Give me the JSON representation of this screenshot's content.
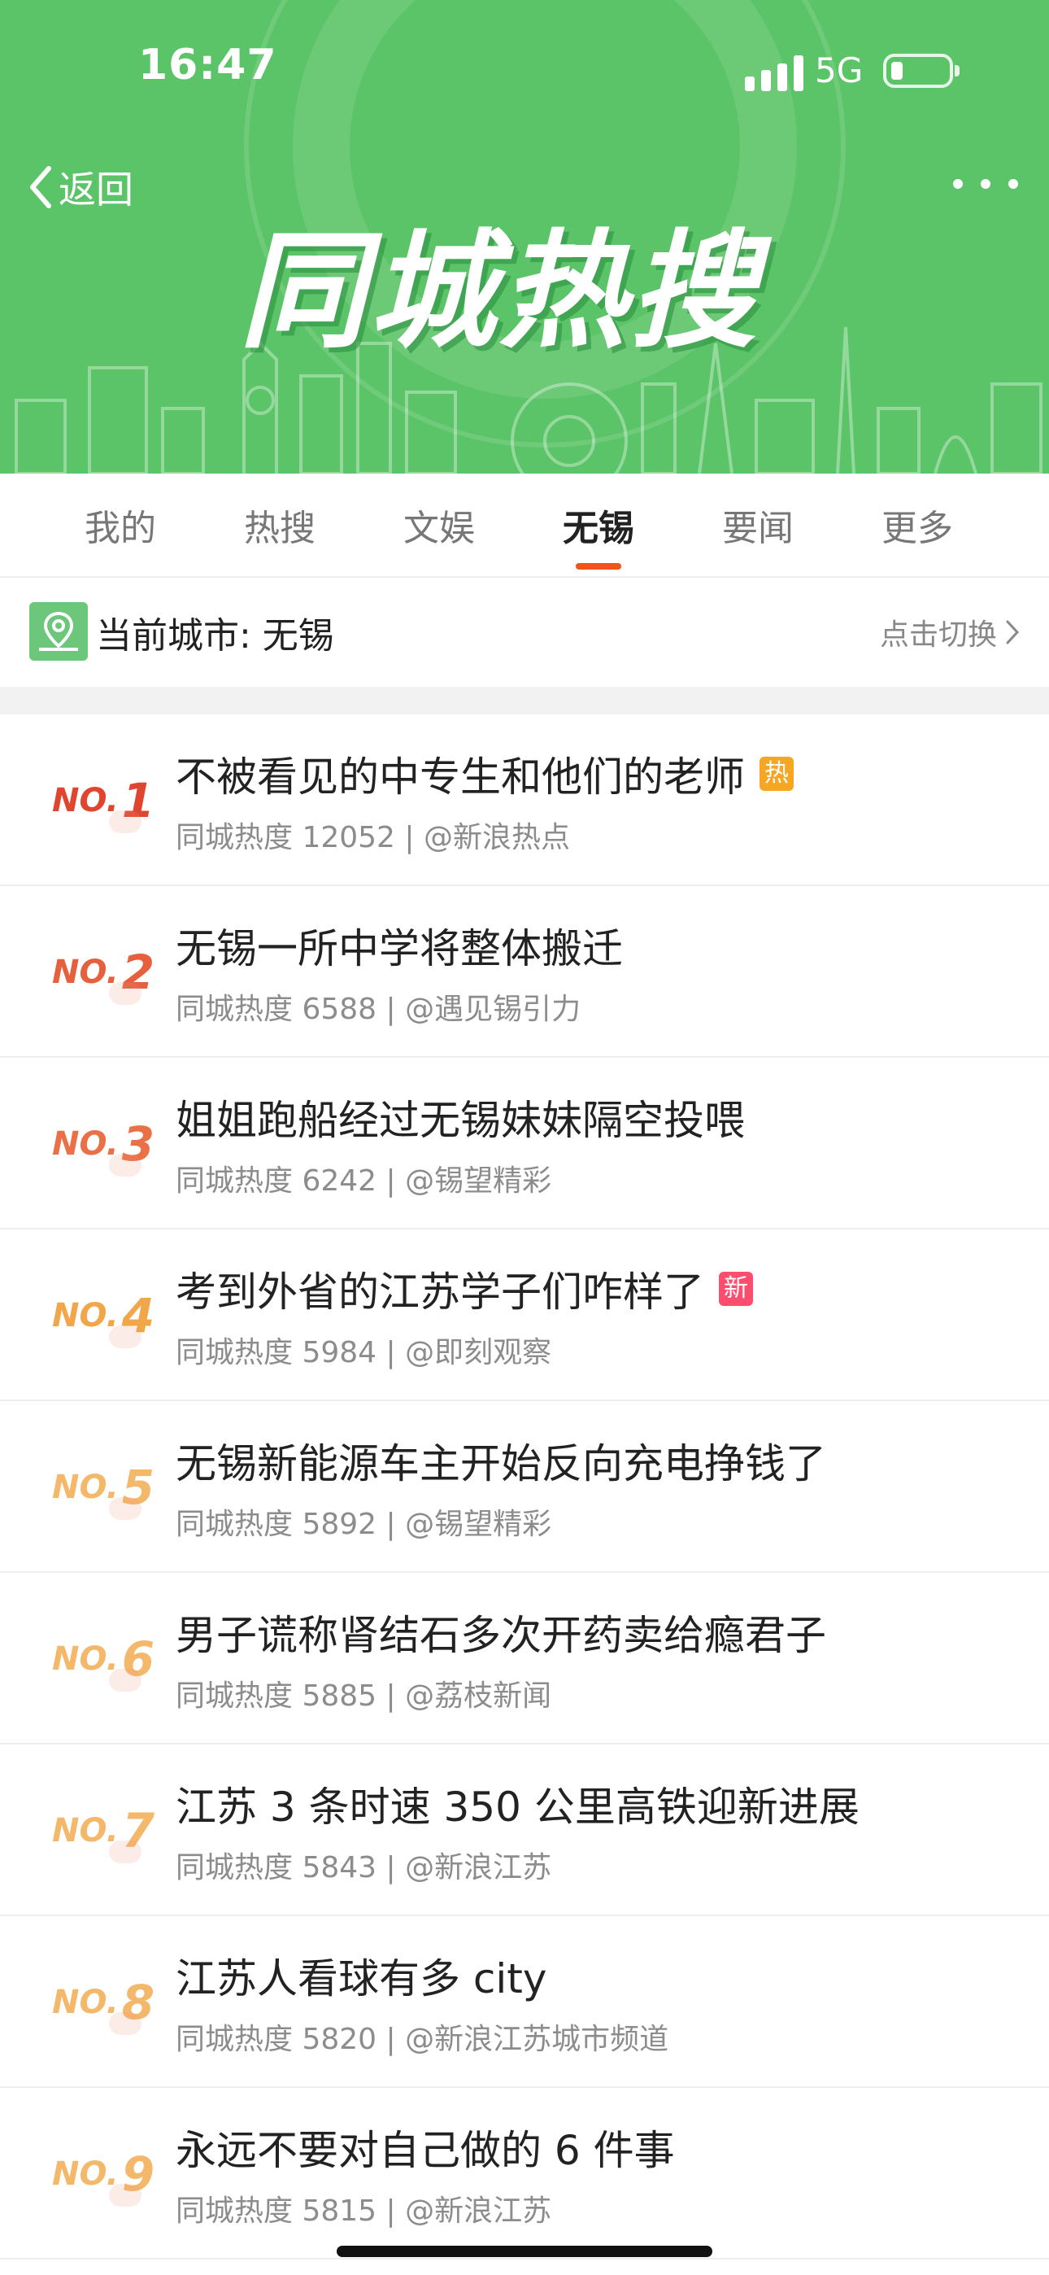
{
  "status": {
    "time": "16:47",
    "network": "5G"
  },
  "nav": {
    "back_label": "返回",
    "banner_title": "同城热搜"
  },
  "tabs": [
    {
      "label": "我的",
      "active": false
    },
    {
      "label": "热搜",
      "active": false
    },
    {
      "label": "文娱",
      "active": false
    },
    {
      "label": "无锡",
      "active": true
    },
    {
      "label": "要闻",
      "active": false
    },
    {
      "label": "更多",
      "active": false
    }
  ],
  "city": {
    "label": "当前城市: 无锡",
    "switch_label": "点击切换"
  },
  "items": [
    {
      "no": "NO.",
      "rank": "1",
      "title": "不被看见的中专生和他们的老师",
      "badge": "热",
      "badge_type": "hot",
      "meta": "同城热度 12052 | @新浪热点",
      "rank_color": "#e0462f"
    },
    {
      "no": "NO.",
      "rank": "2",
      "title": "无锡一所中学将整体搬迁",
      "badge": "",
      "badge_type": "",
      "meta": "同城热度 6588 | @遇见锡引力",
      "rank_color": "#e6603e"
    },
    {
      "no": "NO.",
      "rank": "3",
      "title": "姐姐跑船经过无锡妹妹隔空投喂",
      "badge": "",
      "badge_type": "",
      "meta": "同城热度 6242 | @锡望精彩",
      "rank_color": "#ea7048"
    },
    {
      "no": "NO.",
      "rank": "4",
      "title": "考到外省的江苏学子们咋样了",
      "badge": "新",
      "badge_type": "new",
      "meta": "同城热度 5984 | @即刻观察",
      "rank_color": "#f2a64a"
    },
    {
      "no": "NO.",
      "rank": "5",
      "title": "无锡新能源车主开始反向充电挣钱了",
      "badge": "",
      "badge_type": "",
      "meta": "同城热度 5892 | @锡望精彩",
      "rank_color": "#f4b86a"
    },
    {
      "no": "NO.",
      "rank": "6",
      "title": "男子谎称肾结石多次开药卖给瘾君子",
      "badge": "",
      "badge_type": "",
      "meta": "同城热度 5885 | @荔枝新闻",
      "rank_color": "#f4b86a"
    },
    {
      "no": "NO.",
      "rank": "7",
      "title": "江苏 3 条时速 350 公里高铁迎新进展",
      "badge": "",
      "badge_type": "",
      "meta": "同城热度 5843 | @新浪江苏",
      "rank_color": "#f4b86a"
    },
    {
      "no": "NO.",
      "rank": "8",
      "title": "江苏人看球有多 city",
      "badge": "",
      "badge_type": "",
      "meta": "同城热度 5820 | @新浪江苏城市频道",
      "rank_color": "#f4b86a"
    },
    {
      "no": "NO.",
      "rank": "9",
      "title": "永远不要对自己做的 6 件事",
      "badge": "",
      "badge_type": "",
      "meta": "同城热度 5815 | @新浪江苏",
      "rank_color": "#f4b86a"
    }
  ]
}
